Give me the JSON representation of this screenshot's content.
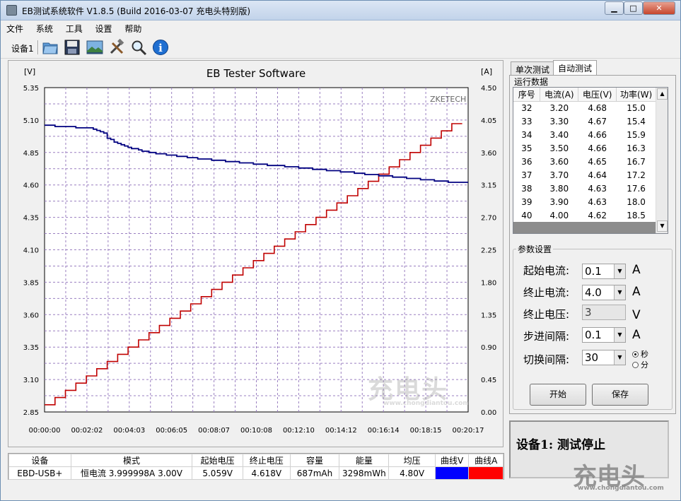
{
  "window": {
    "title": "EB测试系统软件 V1.8.5 (Build 2016-03-07 充电头特别版)"
  },
  "menu": [
    "文件",
    "系统",
    "工具",
    "设置",
    "帮助"
  ],
  "toolbar": {
    "device_label": "设备1",
    "buttons": [
      "open-folder-icon",
      "save-disk-icon",
      "picture-icon",
      "tools-icon",
      "magnifier-icon",
      "info-icon"
    ]
  },
  "chart_data": {
    "type": "line",
    "title": "EB Tester Software",
    "brand_text": "ZKETECH",
    "y_left_unit": "[V]",
    "y_right_unit": "[A]",
    "y_left_ticks": [
      "5.35",
      "5.10",
      "4.85",
      "4.60",
      "4.35",
      "4.10",
      "3.85",
      "3.60",
      "3.35",
      "3.10",
      "2.85"
    ],
    "y_right_ticks": [
      "4.50",
      "4.05",
      "3.60",
      "3.15",
      "2.70",
      "2.25",
      "1.80",
      "1.35",
      "0.90",
      "0.45",
      "0.00"
    ],
    "x_ticks": [
      "00:00:00",
      "00:02:02",
      "00:04:03",
      "00:06:05",
      "00:08:07",
      "00:10:08",
      "00:12:10",
      "00:14:12",
      "00:16:14",
      "00:18:15",
      "00:20:17"
    ],
    "ylim_left": [
      2.85,
      5.35
    ],
    "ylim_right": [
      0,
      4.5
    ],
    "xlim_seconds": [
      0,
      1217
    ],
    "grid": true,
    "series": [
      {
        "name": "曲线V",
        "color": "#000080",
        "axis": "left",
        "x_seconds": [
          0,
          30,
          90,
          140,
          150,
          160,
          170,
          180,
          190,
          200,
          210,
          220,
          230,
          240,
          250,
          260,
          270,
          280,
          290,
          300,
          310,
          320,
          330,
          340,
          350,
          360,
          370,
          380,
          390,
          400,
          410,
          420,
          430,
          440,
          450,
          460,
          470,
          480,
          490,
          500,
          510,
          520,
          530,
          540,
          550,
          560,
          570,
          580,
          590,
          600,
          610,
          620,
          630,
          640,
          650,
          660,
          670,
          680,
          690,
          700,
          710,
          720,
          730,
          740,
          750,
          760,
          770,
          780,
          790,
          800,
          810,
          820,
          830,
          840,
          850,
          860,
          870,
          880,
          890,
          900,
          910,
          920,
          930,
          940,
          950,
          960,
          970,
          980,
          990,
          1000,
          1010,
          1020,
          1030,
          1040,
          1050,
          1060,
          1070,
          1080,
          1090,
          1100,
          1110,
          1120,
          1130,
          1140,
          1150,
          1160,
          1170,
          1180,
          1190,
          1200,
          1210
        ],
        "values": [
          5.06,
          5.05,
          5.04,
          5.03,
          5.02,
          5.01,
          5.0,
          4.96,
          4.95,
          4.93,
          4.92,
          4.91,
          4.9,
          4.89,
          4.88,
          4.88,
          4.87,
          4.86,
          4.86,
          4.85,
          4.85,
          4.84,
          4.84,
          4.84,
          4.83,
          4.83,
          4.83,
          4.82,
          4.82,
          4.82,
          4.81,
          4.81,
          4.81,
          4.8,
          4.8,
          4.8,
          4.8,
          4.79,
          4.79,
          4.79,
          4.79,
          4.78,
          4.78,
          4.78,
          4.78,
          4.77,
          4.77,
          4.77,
          4.77,
          4.76,
          4.76,
          4.76,
          4.76,
          4.75,
          4.75,
          4.75,
          4.75,
          4.75,
          4.74,
          4.74,
          4.74,
          4.74,
          4.73,
          4.73,
          4.73,
          4.73,
          4.72,
          4.72,
          4.72,
          4.72,
          4.71,
          4.71,
          4.71,
          4.71,
          4.7,
          4.7,
          4.7,
          4.7,
          4.69,
          4.69,
          4.69,
          4.68,
          4.68,
          4.68,
          4.68,
          4.67,
          4.67,
          4.67,
          4.67,
          4.66,
          4.66,
          4.66,
          4.66,
          4.65,
          4.65,
          4.65,
          4.65,
          4.64,
          4.64,
          4.64,
          4.64,
          4.63,
          4.63,
          4.63,
          4.63,
          4.62,
          4.62,
          4.62,
          4.62,
          4.62,
          4.62
        ]
      },
      {
        "name": "曲线A",
        "color": "#c00000",
        "axis": "right",
        "step_seconds": 30,
        "values": [
          0.1,
          0.2,
          0.3,
          0.4,
          0.5,
          0.6,
          0.7,
          0.8,
          0.9,
          1.0,
          1.1,
          1.2,
          1.3,
          1.4,
          1.5,
          1.6,
          1.7,
          1.8,
          1.9,
          2.0,
          2.1,
          2.2,
          2.3,
          2.4,
          2.5,
          2.6,
          2.7,
          2.8,
          2.9,
          3.0,
          3.1,
          3.2,
          3.3,
          3.4,
          3.5,
          3.6,
          3.7,
          3.8,
          3.9,
          4.0
        ]
      }
    ]
  },
  "tabs": [
    "单次测试",
    "自动测试"
  ],
  "run_data": {
    "title": "运行数据",
    "columns": [
      "序号",
      "电流(A)",
      "电压(V)",
      "功率(W)"
    ],
    "rows": [
      [
        "32",
        "3.20",
        "4.68",
        "15.0"
      ],
      [
        "33",
        "3.30",
        "4.67",
        "15.4"
      ],
      [
        "34",
        "3.40",
        "4.66",
        "15.9"
      ],
      [
        "35",
        "3.50",
        "4.66",
        "16.3"
      ],
      [
        "36",
        "3.60",
        "4.65",
        "16.7"
      ],
      [
        "37",
        "3.70",
        "4.64",
        "17.2"
      ],
      [
        "38",
        "3.80",
        "4.63",
        "17.6"
      ],
      [
        "39",
        "3.90",
        "4.63",
        "18.0"
      ],
      [
        "40",
        "4.00",
        "4.62",
        "18.5"
      ]
    ]
  },
  "params": {
    "title": "参数设置",
    "start_current_label": "起始电流:",
    "start_current": "0.1",
    "end_current_label": "终止电流:",
    "end_current": "4.0",
    "end_voltage_label": "终止电压:",
    "end_voltage": "3",
    "step_label": "步进间隔:",
    "step": "0.1",
    "switch_label": "切换间隔:",
    "switch": "30",
    "unit_a": "A",
    "unit_v": "V",
    "radio_sec": "秒",
    "radio_min": "分",
    "start_button": "开始",
    "save_button": "保存"
  },
  "status": "设备1: 测试停止",
  "summary": {
    "columns": [
      "设备",
      "模式",
      "起始电压",
      "终止电压",
      "容量",
      "能量",
      "均压",
      "曲线V",
      "曲线A"
    ],
    "row": [
      "EBD-USB+",
      "恒电流  3.999998A  3.00V",
      "5.059V",
      "4.618V",
      "687mAh",
      "3298mWh",
      "4.80V"
    ],
    "curve_v_color": "#0000ff",
    "curve_a_color": "#ff0000"
  },
  "watermark": {
    "logo": "充电头",
    "url": "www.chongdiantou.com"
  }
}
